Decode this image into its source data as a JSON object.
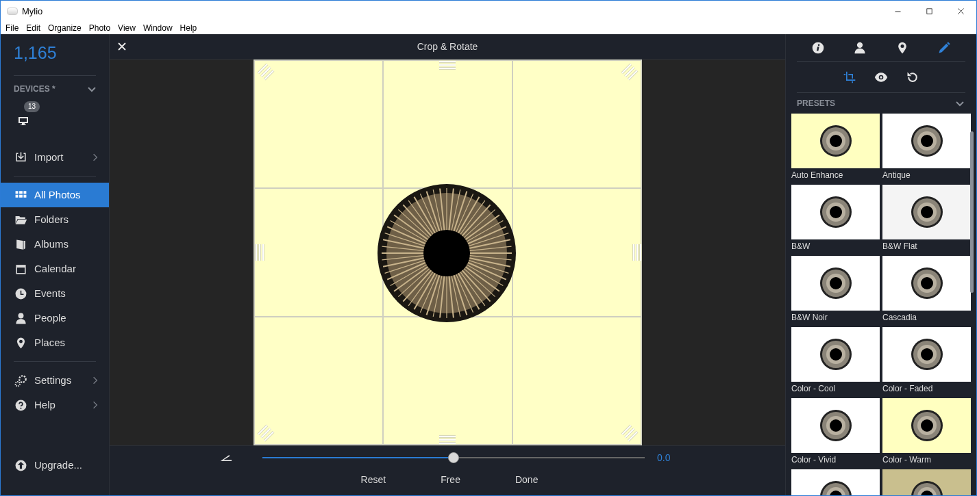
{
  "window": {
    "title": "Mylio"
  },
  "menu": [
    "File",
    "Edit",
    "Organize",
    "Photo",
    "View",
    "Window",
    "Help"
  ],
  "sidebar": {
    "count": "1,165",
    "devices": {
      "title": "DEVICES *",
      "badge": "13",
      "expanded": true
    },
    "groups": [
      [
        {
          "label": "Import",
          "chevron": true,
          "selected": false
        }
      ],
      [
        {
          "label": "All Photos",
          "chevron": false,
          "selected": true
        },
        {
          "label": "Folders",
          "chevron": false,
          "selected": false
        },
        {
          "label": "Albums",
          "chevron": false,
          "selected": false
        },
        {
          "label": "Calendar",
          "chevron": false,
          "selected": false
        },
        {
          "label": "Events",
          "chevron": false,
          "selected": false
        },
        {
          "label": "People",
          "chevron": false,
          "selected": false
        },
        {
          "label": "Places",
          "chevron": false,
          "selected": false
        }
      ],
      [
        {
          "label": "Settings",
          "chevron": true,
          "selected": false
        },
        {
          "label": "Help",
          "chevron": true,
          "selected": false
        }
      ]
    ],
    "upgrade": "Upgrade..."
  },
  "editor": {
    "title": "Crop & Rotate",
    "straighten": {
      "level": 0.5,
      "reading": "0.0"
    },
    "buttons": [
      "Reset",
      "Free",
      "Done"
    ]
  },
  "panel": {
    "tabs": [
      {
        "selected": false
      },
      {
        "selected": false
      },
      {
        "selected": false
      },
      {
        "selected": true
      }
    ],
    "tools": [
      {
        "selected": true
      },
      {
        "selected": false
      },
      {
        "selected": false
      }
    ],
    "presets_title": "PRESETS",
    "presets_expanded": true,
    "presets": [
      {
        "label": "Auto Enhance",
        "color": "#ffffc0"
      },
      {
        "label": "Antique",
        "color": "#ffffff"
      },
      {
        "label": "B&W",
        "color": "#ffffff"
      },
      {
        "label": "B&W Flat",
        "color": "#f4f4f4"
      },
      {
        "label": "B&W Noir",
        "color": "#ffffff"
      },
      {
        "label": "Cascadia",
        "color": "#ffffff"
      },
      {
        "label": "Color - Cool",
        "color": "#ffffff"
      },
      {
        "label": "Color - Faded",
        "color": "#ffffff"
      },
      {
        "label": "Color - Vivid",
        "color": "#ffffff"
      },
      {
        "label": "Color - Warm",
        "color": "#ffffc0"
      },
      {
        "color": "#ffffff"
      },
      {
        "color": "#c9bf8e"
      }
    ]
  }
}
